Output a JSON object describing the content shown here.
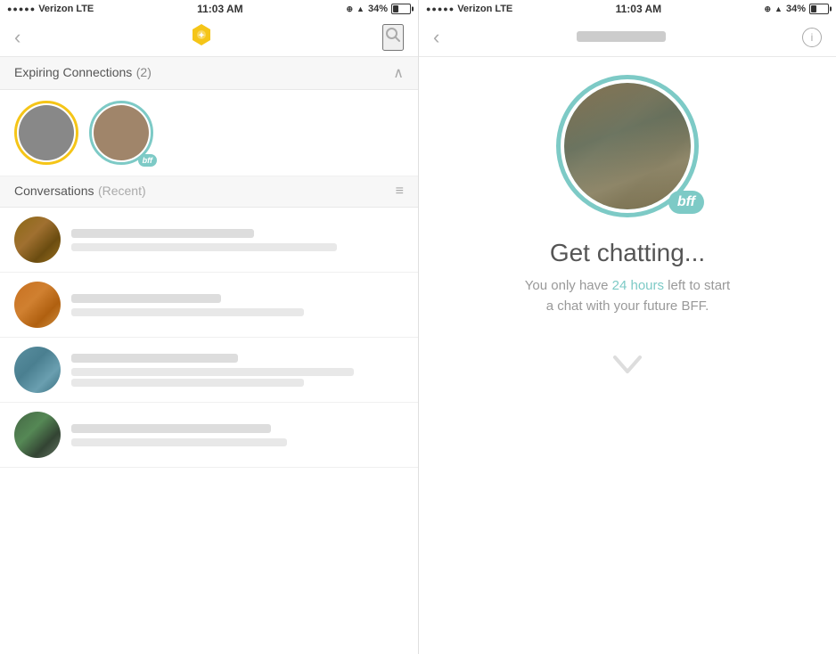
{
  "left_panel": {
    "status_bar": {
      "carrier": "Verizon",
      "network": "LTE",
      "time": "11:03 AM",
      "battery_pct": 34
    },
    "nav": {
      "back_label": "‹",
      "logo_alt": "Bumble logo",
      "search_label": "🔍"
    },
    "expiring_section": {
      "title": "Expiring Connections",
      "count": "(2)",
      "collapse_icon": "chevron-up"
    },
    "expiring_avatars": [
      {
        "id": "exp-1",
        "ring": "yellow",
        "pixel_class": "pixel-dark"
      },
      {
        "id": "exp-2",
        "ring": "teal",
        "pixel_class": "pixel-teal",
        "badge": "bff"
      }
    ],
    "conversations_section": {
      "title": "Conversations",
      "subtitle": "(Recent)",
      "filter_icon": "≡"
    },
    "conversations": [
      {
        "id": "c1",
        "pixel_class": "pixel-brown",
        "name_width": "55%",
        "msg_width": "80%"
      },
      {
        "id": "c2",
        "pixel_class": "pixel-brown",
        "name_width": "45%",
        "msg_width": "70%"
      },
      {
        "id": "c3",
        "pixel_class": "pixel-blue",
        "name_width": "50%",
        "msg_width": "85%"
      },
      {
        "id": "c4",
        "pixel_class": "pixel-green-dark",
        "name_width": "60%",
        "msg_width": "65%"
      }
    ]
  },
  "right_panel": {
    "status_bar": {
      "carrier": "Verizon",
      "network": "LTE",
      "time": "11:03 AM",
      "battery_pct": 34
    },
    "nav": {
      "back_label": "‹",
      "title_blurred": true,
      "info_icon": "ℹ"
    },
    "profile": {
      "pixel_class": "pixel-teal",
      "bff_badge": "bff"
    },
    "chat_prompt": {
      "title": "Get chatting...",
      "subtitle_part1": "You only have ",
      "subtitle_highlight": "24 hours",
      "subtitle_part2": " left to start a chat with your future BFF."
    },
    "arrow_down": "↓"
  }
}
